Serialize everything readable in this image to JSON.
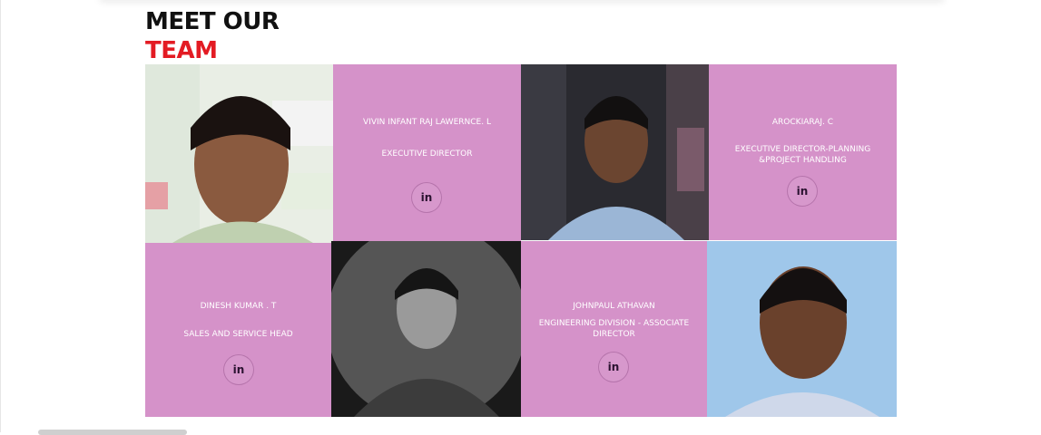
{
  "section": {
    "title_line1": "MEET OUR",
    "title_line2": "TEAM"
  },
  "members": [
    {
      "name": "VIVIN INFANT RAJ LAWERNCE. L",
      "role": "EXECUTIVE DIRECTOR",
      "social_icon": "linkedin-icon",
      "social_label": "in"
    },
    {
      "name": "AROCKIARAJ. C",
      "role": "EXECUTIVE DIRECTOR-PLANNING &PROJECT HANDLING",
      "social_icon": "linkedin-icon",
      "social_label": "in"
    },
    {
      "name": "DINESH KUMAR . T",
      "role": "SALES AND SERVICE HEAD",
      "social_icon": "linkedin-icon",
      "social_label": "in"
    },
    {
      "name": "JOHNPAUL ATHAVAN",
      "role": "ENGINEERING DIVISION - ASSOCIATE DIRECTOR",
      "social_icon": "linkedin-icon",
      "social_label": "in"
    }
  ],
  "photos": [
    {
      "subject": "member-photo",
      "style": "color"
    },
    {
      "subject": "member-photo",
      "style": "color"
    },
    {
      "subject": "member-photo",
      "style": "grayscale"
    },
    {
      "subject": "member-photo",
      "style": "color"
    }
  ],
  "colors": {
    "card_bg": "#d592c9",
    "title_black": "#111111",
    "title_red": "#e31b23",
    "card_text": "#ffffff"
  }
}
